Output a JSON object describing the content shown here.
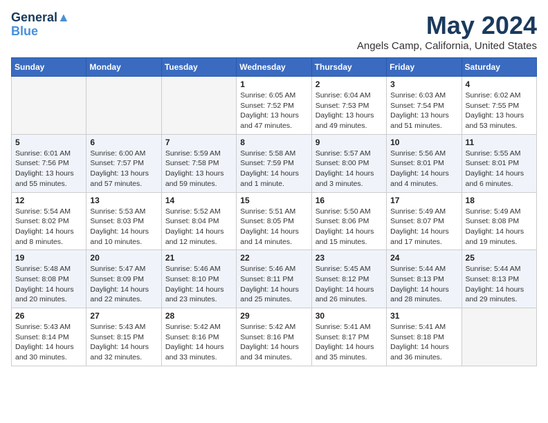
{
  "header": {
    "logo_line1": "General",
    "logo_line2": "Blue",
    "month_year": "May 2024",
    "location": "Angels Camp, California, United States"
  },
  "weekdays": [
    "Sunday",
    "Monday",
    "Tuesday",
    "Wednesday",
    "Thursday",
    "Friday",
    "Saturday"
  ],
  "weeks": [
    [
      {
        "day": "",
        "info": ""
      },
      {
        "day": "",
        "info": ""
      },
      {
        "day": "",
        "info": ""
      },
      {
        "day": "1",
        "info": "Sunrise: 6:05 AM\nSunset: 7:52 PM\nDaylight: 13 hours\nand 47 minutes."
      },
      {
        "day": "2",
        "info": "Sunrise: 6:04 AM\nSunset: 7:53 PM\nDaylight: 13 hours\nand 49 minutes."
      },
      {
        "day": "3",
        "info": "Sunrise: 6:03 AM\nSunset: 7:54 PM\nDaylight: 13 hours\nand 51 minutes."
      },
      {
        "day": "4",
        "info": "Sunrise: 6:02 AM\nSunset: 7:55 PM\nDaylight: 13 hours\nand 53 minutes."
      }
    ],
    [
      {
        "day": "5",
        "info": "Sunrise: 6:01 AM\nSunset: 7:56 PM\nDaylight: 13 hours\nand 55 minutes."
      },
      {
        "day": "6",
        "info": "Sunrise: 6:00 AM\nSunset: 7:57 PM\nDaylight: 13 hours\nand 57 minutes."
      },
      {
        "day": "7",
        "info": "Sunrise: 5:59 AM\nSunset: 7:58 PM\nDaylight: 13 hours\nand 59 minutes."
      },
      {
        "day": "8",
        "info": "Sunrise: 5:58 AM\nSunset: 7:59 PM\nDaylight: 14 hours\nand 1 minute."
      },
      {
        "day": "9",
        "info": "Sunrise: 5:57 AM\nSunset: 8:00 PM\nDaylight: 14 hours\nand 3 minutes."
      },
      {
        "day": "10",
        "info": "Sunrise: 5:56 AM\nSunset: 8:01 PM\nDaylight: 14 hours\nand 4 minutes."
      },
      {
        "day": "11",
        "info": "Sunrise: 5:55 AM\nSunset: 8:01 PM\nDaylight: 14 hours\nand 6 minutes."
      }
    ],
    [
      {
        "day": "12",
        "info": "Sunrise: 5:54 AM\nSunset: 8:02 PM\nDaylight: 14 hours\nand 8 minutes."
      },
      {
        "day": "13",
        "info": "Sunrise: 5:53 AM\nSunset: 8:03 PM\nDaylight: 14 hours\nand 10 minutes."
      },
      {
        "day": "14",
        "info": "Sunrise: 5:52 AM\nSunset: 8:04 PM\nDaylight: 14 hours\nand 12 minutes."
      },
      {
        "day": "15",
        "info": "Sunrise: 5:51 AM\nSunset: 8:05 PM\nDaylight: 14 hours\nand 14 minutes."
      },
      {
        "day": "16",
        "info": "Sunrise: 5:50 AM\nSunset: 8:06 PM\nDaylight: 14 hours\nand 15 minutes."
      },
      {
        "day": "17",
        "info": "Sunrise: 5:49 AM\nSunset: 8:07 PM\nDaylight: 14 hours\nand 17 minutes."
      },
      {
        "day": "18",
        "info": "Sunrise: 5:49 AM\nSunset: 8:08 PM\nDaylight: 14 hours\nand 19 minutes."
      }
    ],
    [
      {
        "day": "19",
        "info": "Sunrise: 5:48 AM\nSunset: 8:08 PM\nDaylight: 14 hours\nand 20 minutes."
      },
      {
        "day": "20",
        "info": "Sunrise: 5:47 AM\nSunset: 8:09 PM\nDaylight: 14 hours\nand 22 minutes."
      },
      {
        "day": "21",
        "info": "Sunrise: 5:46 AM\nSunset: 8:10 PM\nDaylight: 14 hours\nand 23 minutes."
      },
      {
        "day": "22",
        "info": "Sunrise: 5:46 AM\nSunset: 8:11 PM\nDaylight: 14 hours\nand 25 minutes."
      },
      {
        "day": "23",
        "info": "Sunrise: 5:45 AM\nSunset: 8:12 PM\nDaylight: 14 hours\nand 26 minutes."
      },
      {
        "day": "24",
        "info": "Sunrise: 5:44 AM\nSunset: 8:13 PM\nDaylight: 14 hours\nand 28 minutes."
      },
      {
        "day": "25",
        "info": "Sunrise: 5:44 AM\nSunset: 8:13 PM\nDaylight: 14 hours\nand 29 minutes."
      }
    ],
    [
      {
        "day": "26",
        "info": "Sunrise: 5:43 AM\nSunset: 8:14 PM\nDaylight: 14 hours\nand 30 minutes."
      },
      {
        "day": "27",
        "info": "Sunrise: 5:43 AM\nSunset: 8:15 PM\nDaylight: 14 hours\nand 32 minutes."
      },
      {
        "day": "28",
        "info": "Sunrise: 5:42 AM\nSunset: 8:16 PM\nDaylight: 14 hours\nand 33 minutes."
      },
      {
        "day": "29",
        "info": "Sunrise: 5:42 AM\nSunset: 8:16 PM\nDaylight: 14 hours\nand 34 minutes."
      },
      {
        "day": "30",
        "info": "Sunrise: 5:41 AM\nSunset: 8:17 PM\nDaylight: 14 hours\nand 35 minutes."
      },
      {
        "day": "31",
        "info": "Sunrise: 5:41 AM\nSunset: 8:18 PM\nDaylight: 14 hours\nand 36 minutes."
      },
      {
        "day": "",
        "info": ""
      }
    ]
  ]
}
